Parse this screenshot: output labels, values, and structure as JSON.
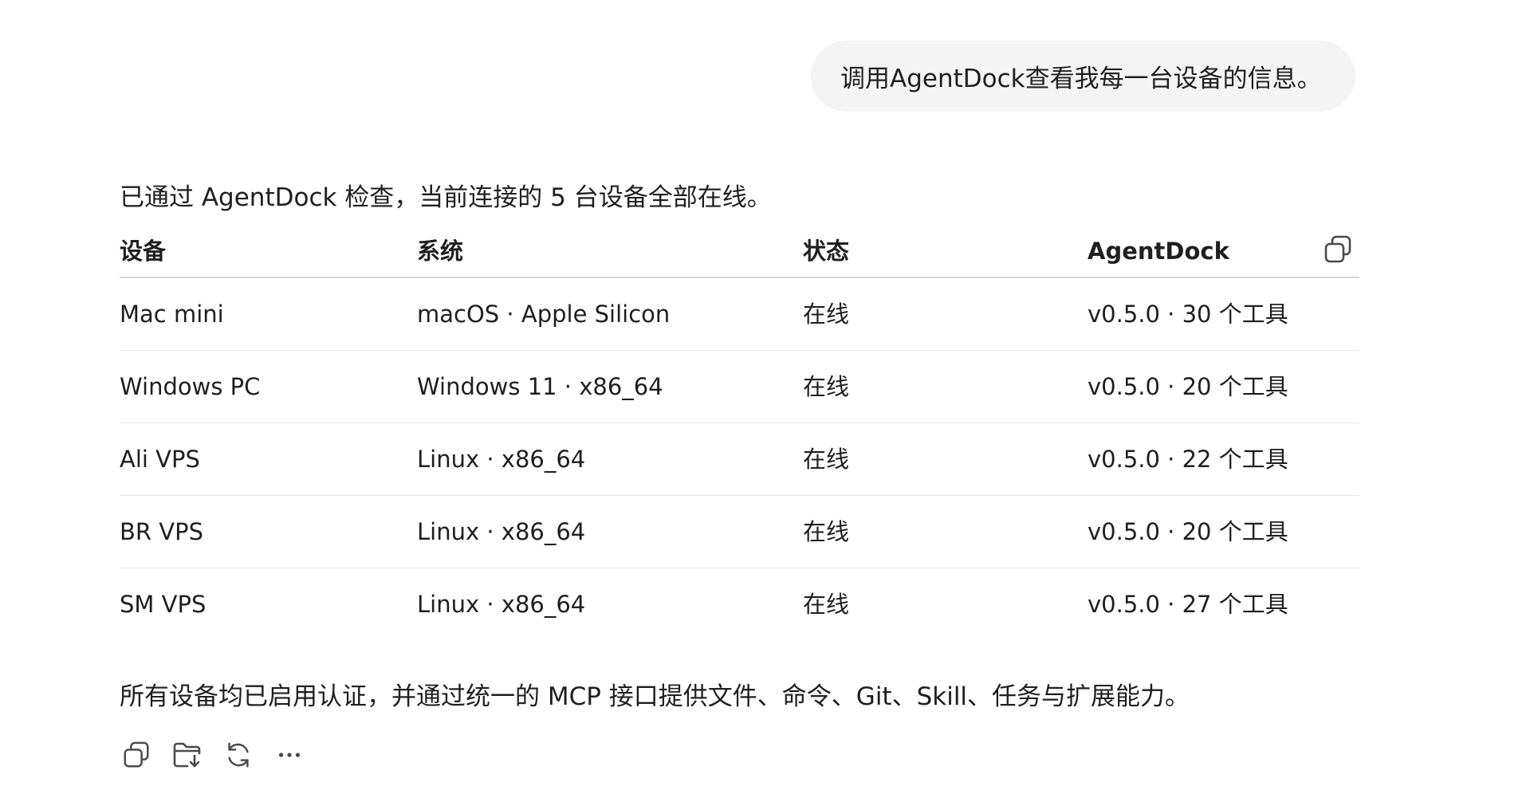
{
  "user_message": "调用AgentDock查看我每一台设备的信息。",
  "response": {
    "intro": "已通过 AgentDock 检查，当前连接的 5 台设备全部在线。",
    "table": {
      "headers": [
        "设备",
        "系统",
        "状态",
        "AgentDock"
      ],
      "rows": [
        [
          "Mac mini",
          "macOS · Apple Silicon",
          "在线",
          "v0.5.0 · 30 个工具"
        ],
        [
          "Windows PC",
          "Windows 11 · x86_64",
          "在线",
          "v0.5.0 · 20 个工具"
        ],
        [
          "Ali VPS",
          "Linux · x86_64",
          "在线",
          "v0.5.0 · 22 个工具"
        ],
        [
          "BR VPS",
          "Linux · x86_64",
          "在线",
          "v0.5.0 · 20 个工具"
        ],
        [
          "SM VPS",
          "Linux · x86_64",
          "在线",
          "v0.5.0 · 27 个工具"
        ]
      ]
    },
    "summary": "所有设备均已启用认证，并通过统一的 MCP 接口提供文件、命令、Git、Skill、任务与扩展能力。"
  },
  "icons": {
    "table_copy": "copy-icon",
    "actions": [
      "copy-icon",
      "save-to-folder-icon",
      "regenerate-icon",
      "more-icon"
    ]
  },
  "colors": {
    "bubble_bg": "#f4f4f4",
    "text": "#1f1f1f",
    "icon": "#4a4a4a",
    "divider": "#e6e6e6"
  }
}
